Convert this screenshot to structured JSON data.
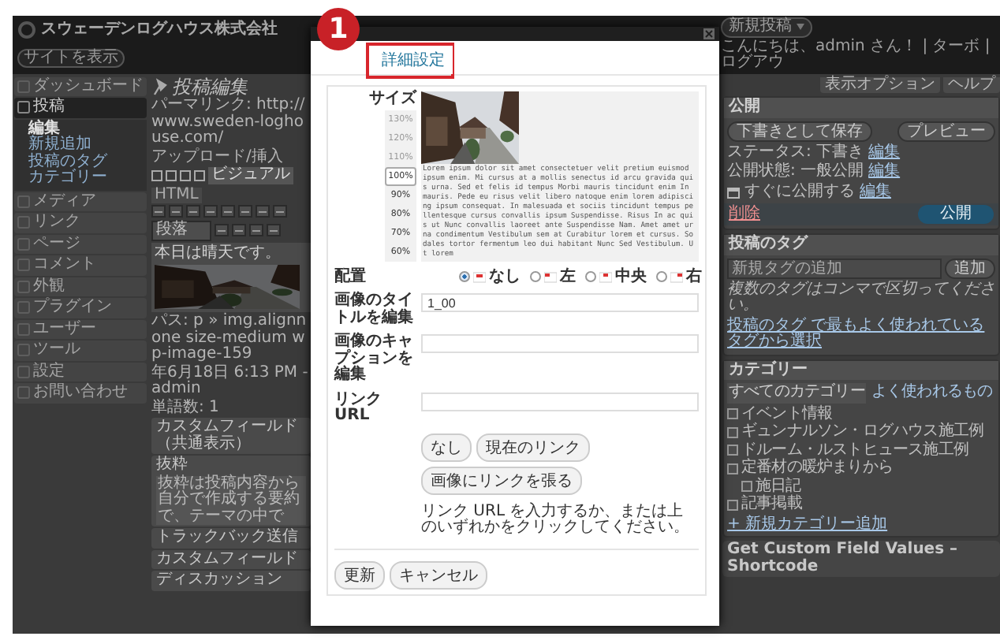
{
  "admin_bar": {
    "site_title": "スウェーデンログハウス株式会社",
    "view_site": "サイトを表示",
    "new_post": "新規投稿",
    "greeting": "こんにちは、admin さん！ | ターボ | ログアウ"
  },
  "screen_links": [
    "表示オプション",
    "ヘルプ"
  ],
  "menu": [
    {
      "label": "ダッシュボード",
      "selected": false
    },
    {
      "label": "投稿",
      "selected": true,
      "children": [
        {
          "label": "編集",
          "selected": true
        },
        {
          "label": "新規追加",
          "selected": false
        },
        {
          "label": "投稿のタグ",
          "selected": false
        },
        {
          "label": "カテゴリー",
          "selected": false
        }
      ]
    },
    {
      "label": "メディア",
      "selected": false
    },
    {
      "label": "リンク",
      "selected": false
    },
    {
      "label": "ページ",
      "selected": false
    },
    {
      "label": "コメント",
      "selected": false
    },
    {
      "label": "外観",
      "selected": false
    },
    {
      "label": "プラグイン",
      "selected": false
    },
    {
      "label": "ユーザー",
      "selected": false
    },
    {
      "label": "ツール",
      "selected": false
    },
    {
      "label": "設定",
      "selected": false
    },
    {
      "label": "お問い合わせ",
      "selected": false
    }
  ],
  "editor": {
    "page_title": "投稿編集",
    "permalink": "パーマリンク: http://www.sweden-loghouse.com/",
    "upload_label": "アップロード/挿入",
    "modes": [
      {
        "label": "ビジュアル",
        "selected": true
      },
      {
        "label": "HTML",
        "selected": false
      }
    ],
    "format": "段落",
    "body_text": "本日は晴天です。",
    "path": "パス: p » img.alignnone size-medium wp-image-159",
    "last_edit": "年6月18日 6:13 PM - admin",
    "word_count": "単語数: 1",
    "sections": [
      {
        "title": "カスタムフィールド（共通表示）"
      },
      {
        "title": "抜粋",
        "hint": "抜粋は投稿内容から自分で作成する要約で、テーマの中で"
      },
      {
        "title": "トラックバック送信"
      },
      {
        "title": "カスタムフィールド"
      },
      {
        "title": "ディスカッション"
      }
    ]
  },
  "sidebar": {
    "publish": {
      "title": "公開",
      "save_draft": "下書きとして保存",
      "preview": "プレビュー",
      "rows": [
        {
          "kind": "info",
          "label": "ステータス: 下書き",
          "link": "編集"
        },
        {
          "kind": "info",
          "label": "公開状態: 一般公開",
          "link": "編集"
        },
        {
          "kind": "schedule",
          "label": "すぐに公開する",
          "link": "編集"
        }
      ],
      "delete": "削除",
      "publish": "公開"
    },
    "tags": {
      "title": "投稿のタグ",
      "placeholder": "新規タグの追加",
      "add": "追加",
      "hint": "複数のタグはコンマで区切ってください。",
      "link": "投稿のタグ で最もよく使われているタグから選択"
    },
    "categories": {
      "title": "カテゴリー",
      "tabs": [
        {
          "label": "すべてのカテゴリー",
          "selected": true
        },
        {
          "label": "よく使われるもの",
          "selected": false
        }
      ],
      "items": [
        {
          "label": "イベント情報",
          "checked": false
        },
        {
          "label": "ギュンナルソン・ログハウス施工例",
          "checked": false
        },
        {
          "label": "ドルーム・ルストヒュース施工例",
          "checked": false
        },
        {
          "label": "定番材の暖炉まりから",
          "checked": false,
          "children": [
            {
              "label": "施日記",
              "checked": false
            }
          ]
        },
        {
          "label": "記事掲載",
          "checked": false
        }
      ],
      "add": "+ 新規カテゴリー追加"
    },
    "custom_box": "Get Custom Field Values – Shortcode"
  },
  "dialog": {
    "annotation": "1",
    "tabs": [
      {
        "label": "詳細設定",
        "selected": true
      }
    ],
    "size_label": "サイズ",
    "sizes": [
      {
        "label": "130%",
        "selected": false,
        "disabled": true
      },
      {
        "label": "120%",
        "selected": false,
        "disabled": true
      },
      {
        "label": "110%",
        "selected": false,
        "disabled": true
      },
      {
        "label": "100%",
        "selected": true,
        "disabled": false
      },
      {
        "label": "90%",
        "selected": false,
        "disabled": false
      },
      {
        "label": "80%",
        "selected": false,
        "disabled": false
      },
      {
        "label": "70%",
        "selected": false,
        "disabled": false
      },
      {
        "label": "60%",
        "selected": false,
        "disabled": false
      }
    ],
    "preview_text": "Lorem ipsum dolor sit amet consectetuer velit pretium euismod ipsum enim. Mi cursus at a mollis senectus id arcu gravida quis urna. Sed et felis id tempus Morbi mauris tincidunt enim In mauris. Pede eu risus velit libero natoque enim lorem adipiscing ipsum consequat. In malesuada et sociis tincidunt tempus pellentesque cursus convallis ipsum Suspendisse. Risus In ac quis ut Nunc convallis laoreet ante Suspendisse Nam. Amet amet urna condimentum Vestibulum sem at Curabitur lorem et cursus. Sodales tortor fermentum leo dui habitant Nunc Sed Vestibulum. Ut lorem",
    "align_label": "配置",
    "align_options": [
      {
        "label": "なし",
        "selected": true
      },
      {
        "label": "左",
        "selected": false
      },
      {
        "label": "中央",
        "selected": false
      },
      {
        "label": "右",
        "selected": false
      }
    ],
    "fields": [
      {
        "label": "画像のタイトルを編集",
        "value": "1_00"
      },
      {
        "label": "画像のキャプションを編集"
      },
      {
        "label": "リンク URL"
      }
    ],
    "link_buttons": [
      "なし",
      "現在のリンク",
      "画像にリンクを張る"
    ],
    "link_hint": "リンク URL を入力するか、または上のいずれかをクリックしてください。",
    "buttons": [
      "更新",
      "キャンセル"
    ]
  }
}
